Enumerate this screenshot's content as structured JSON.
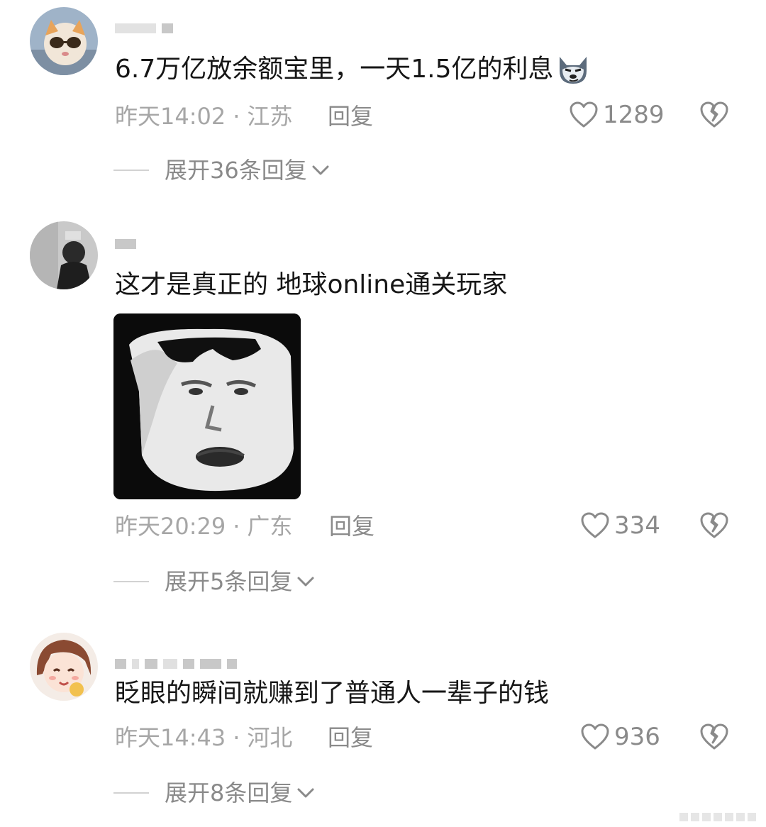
{
  "comments": [
    {
      "text": "6.7万亿放余额宝里，一天1.5亿的利息",
      "inline_emoji": "wolf-face-emoji",
      "time": "昨天14:02",
      "location": "江苏",
      "reply_label": "回复",
      "likes": "1289",
      "expand_label": "展开36条回复"
    },
    {
      "text": "这才是真正的 地球online通关玩家",
      "sticker": "sunglasses-salute-face-sticker",
      "time": "昨天20:29",
      "location": "广东",
      "reply_label": "回复",
      "likes": "334",
      "expand_label": "展开5条回复"
    },
    {
      "text": "眨眼的瞬间就赚到了普通人一辈子的钱",
      "time": "昨天14:43",
      "location": "河北",
      "reply_label": "回复",
      "likes": "936",
      "expand_label": "展开8条回复"
    }
  ],
  "separator": "·",
  "icons": {
    "like": "heart-outline-icon",
    "dislike": "broken-heart-icon",
    "expand": "chevron-down-icon"
  },
  "colors": {
    "text": "#161616",
    "meta": "#a6a6a6",
    "action": "#8a8a8a"
  }
}
